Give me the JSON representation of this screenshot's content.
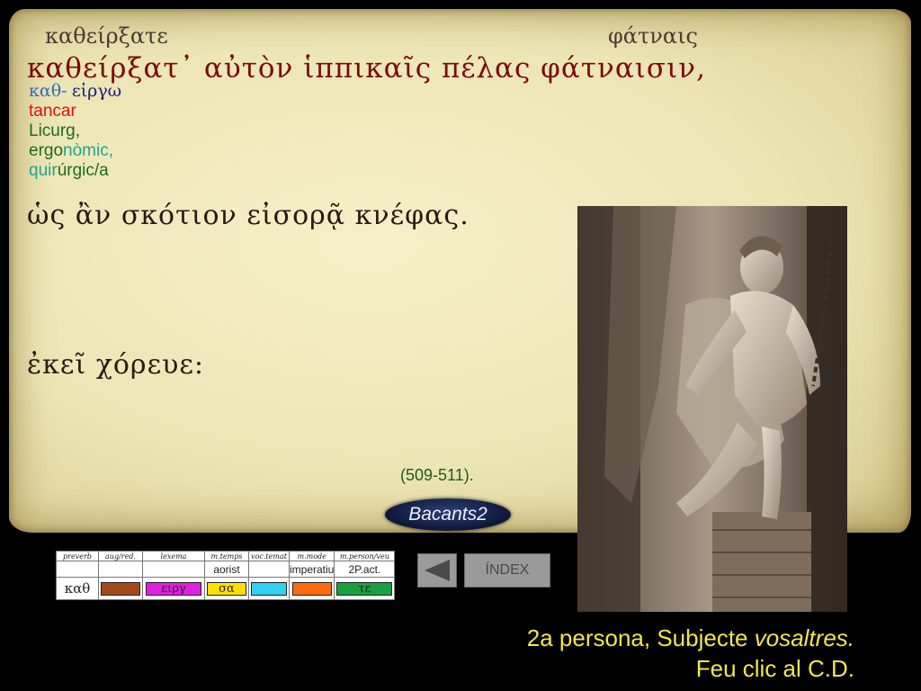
{
  "glosses": {
    "left": "καθείρξατε",
    "right": "φάτναις"
  },
  "verse": {
    "line1": "καθείρξατ᾽ αὐτὸν ἱππικαῖς πέλας φάτναισιν,",
    "line2": "ὡς ἂν σκότιον εἰσορᾷ κνέφας.",
    "line3": "ἐκεῖ χόρευε:"
  },
  "notes": {
    "prefix": "καθ-",
    "root": "εἰργω",
    "meaning": "tancar",
    "derivative1": "Licurg,",
    "derivative2_a": "ergo",
    "derivative2_b": "nòmic,",
    "derivative3_a": "quir",
    "derivative3_b": "úrgic/a"
  },
  "reference": "(509-511).",
  "badge": "Bacants2",
  "morphology": {
    "headers": [
      "preverb",
      "aug/red.",
      "lexema",
      "m.temps",
      "voc.temat",
      "m.mode",
      "m.person/veu"
    ],
    "values": [
      "",
      "",
      "",
      "aorist",
      "",
      "imperatiu",
      "2P.act."
    ],
    "greek": [
      "καθ",
      "",
      "ειργ",
      "σα",
      "",
      "",
      "τε"
    ],
    "colors": [
      "#ffffff",
      "#a04a1a",
      "#e020e0",
      "#ffe000",
      "#30d0f0",
      "#ff6a10",
      "#18a040"
    ]
  },
  "nav": {
    "back_icon": "triangle-left-icon",
    "index_label": "ÍNDEX"
  },
  "caption": {
    "line1_a": "2a persona, Subjecte ",
    "line1_b": "vosaltres.",
    "line2": "Feu clic al C.D."
  }
}
